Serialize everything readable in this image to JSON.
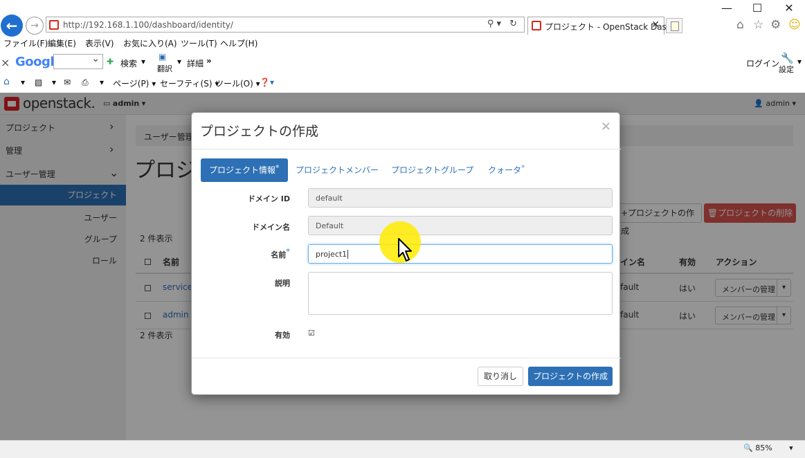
{
  "browser": {
    "url": "http://192.168.1.100/dashboard/identity/",
    "tab_title": "プロジェクト - OpenStack Das...",
    "menu": [
      "ファイル(F)",
      "編集(E)",
      "表示(V)",
      "お気に入り(A)",
      "ツール(T)",
      "ヘルプ(H)"
    ],
    "google_logo": "Google",
    "search_label": "検索",
    "translate_label": "翻訳",
    "details_label": "詳細",
    "login_label": "ログイン",
    "settings_label": "設定",
    "cmd": {
      "page": "ページ(P)",
      "safety": "セーフティ(S)",
      "tools": "ツール(O)"
    },
    "zoom": "85%"
  },
  "os": {
    "logo": "openstack.",
    "project_selector": "admin",
    "user_menu": "admin"
  },
  "sidebar": {
    "items": [
      {
        "label": "プロジェクト"
      },
      {
        "label": "管理"
      },
      {
        "label": "ユーザー管理"
      }
    ],
    "sub_items": [
      {
        "label": "プロジェクト"
      },
      {
        "label": "ユーザー"
      },
      {
        "label": "グループ"
      },
      {
        "label": "ロール"
      }
    ]
  },
  "main": {
    "breadcrumb": "ユーザー管理",
    "title": "プロジ",
    "create_button": "+プロジェクトの作成",
    "delete_button": "🗑プロジェクトの削除",
    "count_text": "2 件表示",
    "columns": {
      "name": "名前",
      "domain": "イン名",
      "enabled": "有効",
      "actions": "アクション"
    },
    "rows": [
      {
        "name": "services",
        "domain": "fault",
        "enabled": "はい",
        "action": "メンバーの管理"
      },
      {
        "name": "admin",
        "domain": "fault",
        "enabled": "はい",
        "action": "メンバーの管理"
      }
    ]
  },
  "modal": {
    "title": "プロジェクトの作成",
    "close": "×",
    "tabs": [
      {
        "label": "プロジェクト情報",
        "required": "*"
      },
      {
        "label": "プロジェクトメンバー",
        "required": ""
      },
      {
        "label": "プロジェクトグループ",
        "required": ""
      },
      {
        "label": "クォータ",
        "required": "*"
      }
    ],
    "fields": {
      "domain_id": {
        "label": "ドメイン ID",
        "value": "default"
      },
      "domain_name": {
        "label": "ドメイン名",
        "value": "Default"
      },
      "name": {
        "label": "名前",
        "required": "*",
        "value": "project1"
      },
      "description": {
        "label": "説明",
        "value": ""
      },
      "enabled": {
        "label": "有効",
        "checked": "☑"
      }
    },
    "cancel": "取り消し",
    "submit": "プロジェクトの作成"
  },
  "colors": {
    "primary": "#2d70b5",
    "danger": "#d9534f",
    "brand_red": "#da1f26",
    "cursor_highlight": "#ffeb00"
  }
}
